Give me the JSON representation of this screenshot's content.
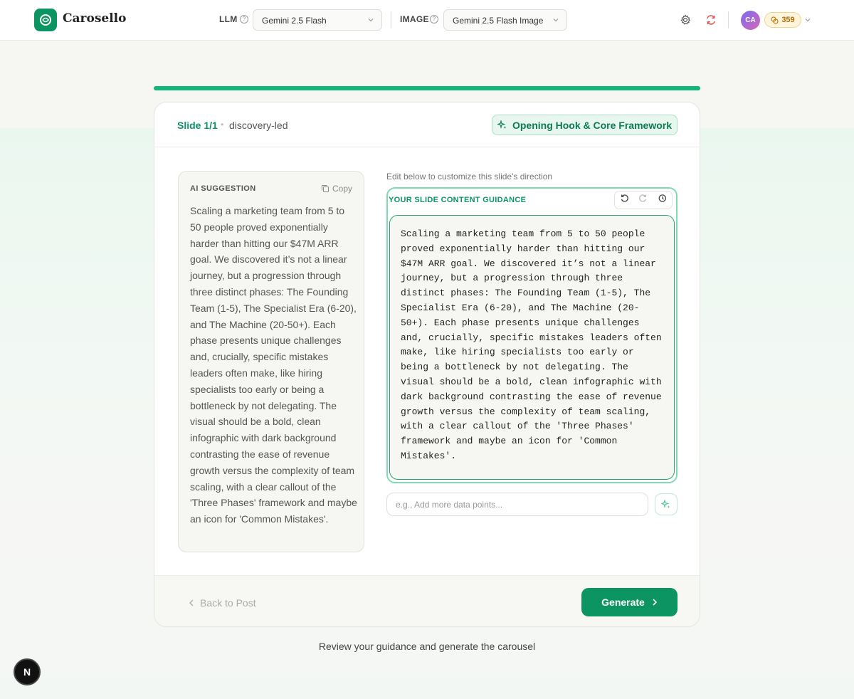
{
  "brand": {
    "name": "Carosello",
    "color": "#0d9463"
  },
  "header": {
    "llm_label": "LLM",
    "llm_value": "Gemini 2.5 Flash",
    "image_label": "IMAGE",
    "image_value": "Gemini 2.5 Flash Image",
    "avatar_initials": "CA",
    "credits": "359"
  },
  "progress": {
    "fraction": 1.0
  },
  "slide": {
    "number": "Slide 1/1",
    "kind": "discovery-led",
    "section_badge": "Opening Hook & Core Framework"
  },
  "ai_suggestion": {
    "title": "AI SUGGESTION",
    "copy_label": "Copy",
    "text": "Scaling a marketing team from 5 to 50 people proved exponentially harder than hitting our $47M ARR goal. We discovered it’s not a linear journey, but a progression through three distinct phases: The Founding Team (1-5), The Specialist Era (6-20), and The Machine (20-50+). Each phase presents unique challenges and, crucially, specific mistakes leaders often make, like hiring specialists too early or being a bottleneck by not delegating. The visual should be a bold, clean infographic with dark background contrasting the ease of revenue growth versus the complexity of team scaling, with a clear callout of the 'Three Phases' framework and maybe an icon for 'Common Mistakes'."
  },
  "guidance": {
    "hint": "Edit below to customize this slide's direction",
    "title": "YOUR SLIDE CONTENT GUIDANCE",
    "text": "Scaling a marketing team from 5 to 50 people proved exponentially harder than hitting our $47M ARR goal. We discovered it’s not a linear journey, but a progression through three distinct phases: The Founding Team (1-5), The Specialist Era (6-20), and The Machine (20-50+). Each phase presents unique challenges and, crucially, specific mistakes leaders often make, like hiring specialists too early or being a bottleneck by not delegating. The visual should be a bold, clean infographic with dark background contrasting the ease of revenue growth versus the complexity of team scaling, with a clear callout of the 'Three Phases' framework and maybe an icon for 'Common Mistakes'.",
    "more_placeholder": "e.g., Add more data points..."
  },
  "footer": {
    "back_label": "Back to Post",
    "generate_label": "Generate",
    "note": "Review your guidance and generate the carousel"
  },
  "dev_badge": "N"
}
